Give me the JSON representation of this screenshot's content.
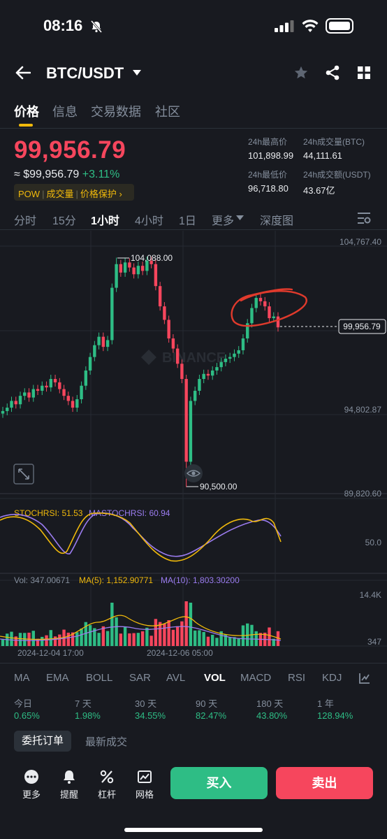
{
  "status_bar": {
    "time": "08:16"
  },
  "header": {
    "pair": "BTC/USDT"
  },
  "tabs": [
    "价格",
    "信息",
    "交易数据",
    "社区"
  ],
  "ticker": {
    "last_price": "99,956.79",
    "fiat_price": "≈ $99,956.79",
    "change": "+3.11%",
    "tags": [
      "POW",
      "成交量",
      "价格保护"
    ],
    "high_label": "24h最高价",
    "high": "101,898.99",
    "vol_btc_label": "24h成交量(BTC)",
    "vol_btc": "44,111.61",
    "low_label": "24h最低价",
    "low": "96,718.80",
    "vol_usdt_label": "24h成交额(USDT)",
    "vol_usdt": "43.67亿"
  },
  "intervals": [
    "分时",
    "15分",
    "1小时",
    "4小时",
    "1日",
    "更多",
    "深度图"
  ],
  "price_axis": {
    "top": "104,767.40",
    "mid": "94,802.87",
    "bottom": "89,820.60",
    "current": "99,956.79",
    "high_mark": "104,088.00",
    "low_mark": "90,500.00"
  },
  "stochrsi": {
    "label": "STOCHRSI: 51.53",
    "ma_label": "MASTOCHRSI: 60.94",
    "level": "50.0"
  },
  "volume": {
    "vol": "Vol: 347.00671",
    "ma5": "MA(5): 1,152.90771",
    "ma10": "MA(10): 1,803.30200",
    "axis_top": "14.4K",
    "axis_bottom": "347"
  },
  "time_labels": [
    "2024-12-04 17:00",
    "2024-12-06 05:00"
  ],
  "indicators": [
    "MA",
    "EMA",
    "BOLL",
    "SAR",
    "AVL",
    "VOL",
    "MACD",
    "RSI",
    "KDJ"
  ],
  "performance": [
    {
      "label": "今日",
      "value": "0.65%"
    },
    {
      "label": "7 天",
      "value": "1.98%"
    },
    {
      "label": "30 天",
      "value": "34.55%"
    },
    {
      "label": "90 天",
      "value": "82.47%"
    },
    {
      "label": "180 天",
      "value": "43.80%"
    },
    {
      "label": "1 年",
      "value": "128.94%"
    }
  ],
  "order_tabs": [
    "委托订单",
    "最新成交"
  ],
  "bottom_nav": [
    "更多",
    "提醒",
    "杠杆",
    "网格"
  ],
  "buy_label": "买入",
  "sell_label": "卖出",
  "watermark": "BINANCE",
  "colors": {
    "up": "#2ebd85",
    "down": "#f6465d",
    "accent": "#f0b90b",
    "bg": "#181a20"
  },
  "chart_data": {
    "type": "candlestick",
    "interval": "1h",
    "ylim": [
      89820.6,
      104767.4
    ],
    "high": 104088.0,
    "low": 90500.0,
    "last": 99956.79,
    "closes": [
      95000,
      95200,
      95600,
      95400,
      95900,
      96100,
      95800,
      96300,
      96200,
      96500,
      96400,
      96900,
      96700,
      96300,
      95900,
      95600,
      95200,
      95700,
      96500,
      97400,
      98200,
      98900,
      99400,
      98800,
      99200,
      102300,
      103700,
      103200,
      103800,
      103500,
      103100,
      103600,
      103300,
      103900,
      103700,
      102400,
      101200,
      100400,
      99300,
      98700,
      97800,
      96900,
      92000,
      95600,
      96200,
      96900,
      97200,
      97100,
      97400,
      97600,
      97900,
      98100,
      98200,
      98400,
      98600,
      99300,
      100200,
      101100,
      101700,
      101500,
      101200,
      100500,
      100600,
      99956.79
    ]
  }
}
